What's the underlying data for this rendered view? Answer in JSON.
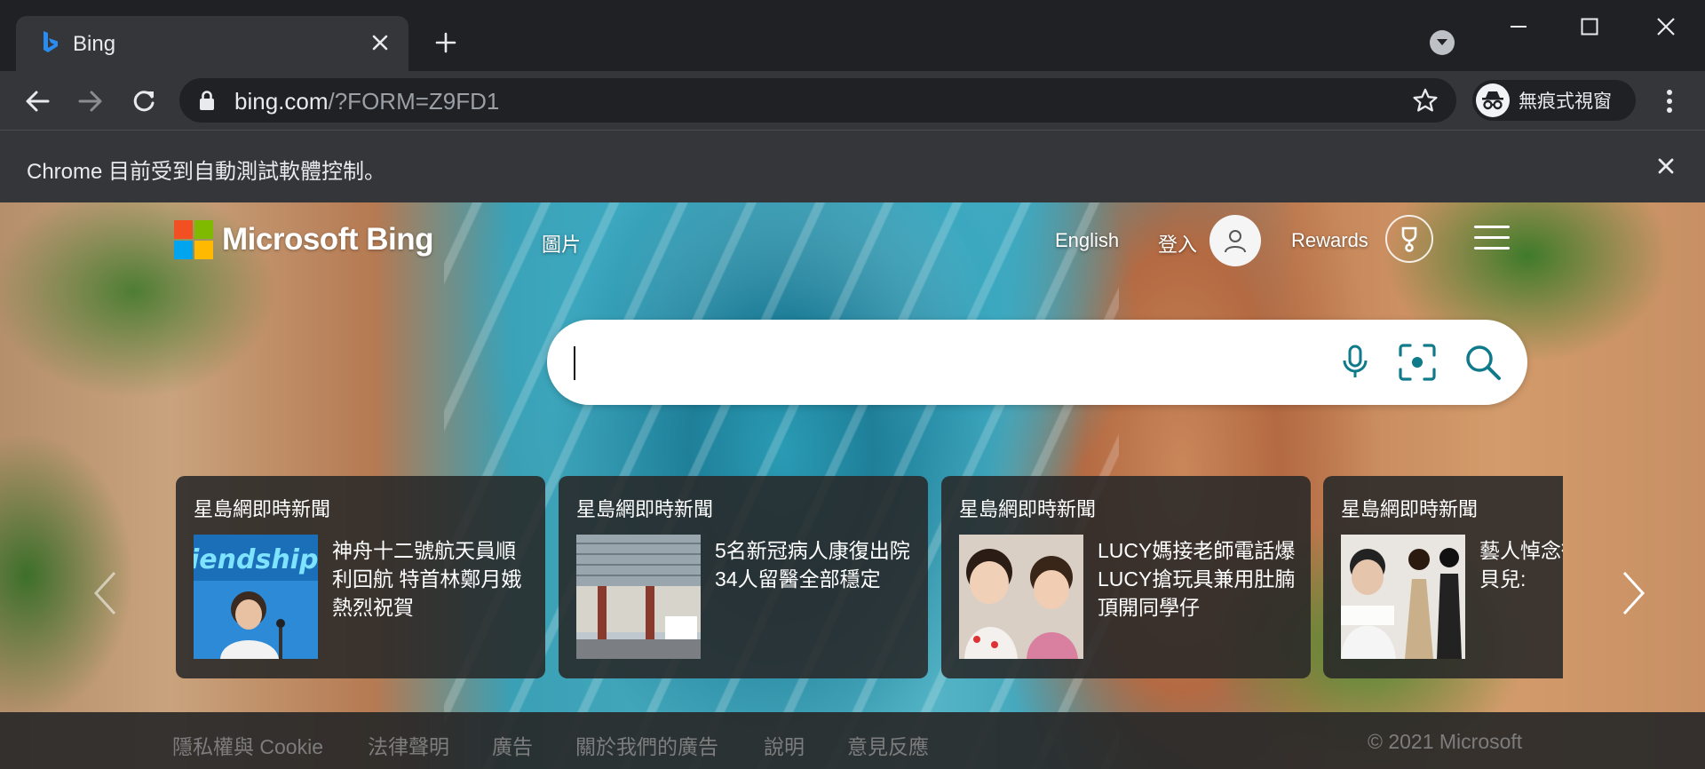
{
  "tab": {
    "title": "Bing",
    "favicon": "bing-logo-icon"
  },
  "toolbar": {
    "url_host": "bing.com",
    "url_path": "/?FORM=Z9FD1",
    "incognito_label": "無痕式視窗"
  },
  "infobar": {
    "message": "Chrome 目前受到自動測試軟體控制。"
  },
  "bing": {
    "logo_text": "Microsoft Bing",
    "nav_images": "圖片",
    "lang_link": "English",
    "signin_link": "登入",
    "rewards_link": "Rewards",
    "search_value": "",
    "cards": [
      {
        "source": "星島網即時新聞",
        "headline": "神舟十二號航天員順利回航 特首林鄭月娥熱烈祝賀"
      },
      {
        "source": "星島網即時新聞",
        "headline": "5名新冠病人康復出院 34人留醫全部穩定"
      },
      {
        "source": "星島網即時新聞",
        "headline": "LUCY媽接老師電話爆LUCY搶玩具兼用肚腩頂開同學仔"
      },
      {
        "source": "星島網即時新聞",
        "headline": "藝人悼念衛世輝死陳貝兒:"
      }
    ],
    "footer": {
      "privacy": "隱私權與 Cookie",
      "legal": "法律聲明",
      "ads": "廣告",
      "about_ads": "關於我們的廣告",
      "help": "說明",
      "feedback": "意見反應",
      "copyright": "© 2021 Microsoft"
    }
  },
  "colors": {
    "bing_teal": "#0e7a8a",
    "chrome_dark": "#202124",
    "chrome_mid": "#35363a"
  }
}
